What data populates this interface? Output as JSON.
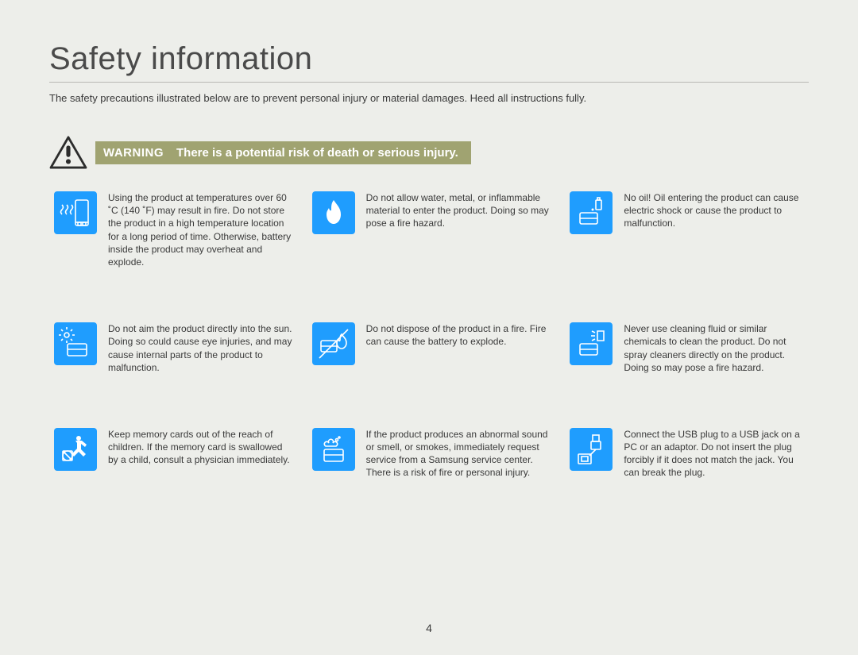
{
  "header": {
    "title": "Safety information",
    "intro": "The safety precautions illustrated below are to prevent personal injury or material damages. Heed all instructions fully."
  },
  "warning": {
    "label": "WARNING",
    "text": "There is a potential risk of death or serious injury."
  },
  "items": [
    {
      "text": "Using the product at temperatures over 60 ˚C (140 ˚F) may result in fire. Do not store the product in a high temperature location for a long period of time. Otherwise, battery inside the product may overheat and explode."
    },
    {
      "text": "Do not allow water, metal, or inflammable material to enter the product. Doing so may pose a fire hazard."
    },
    {
      "text": "No oil! Oil entering the product can cause electric shock or cause the product to malfunction."
    },
    {
      "text": "Do not aim the product directly into the sun. Doing so could cause eye injuries, and may cause internal parts of the product to malfunction."
    },
    {
      "text": "Do not dispose of the product in a fire. Fire can cause the battery to explode."
    },
    {
      "text": "Never use cleaning fluid or similar chemicals to clean the product. Do not spray cleaners directly on the product. Doing so may pose a fire hazard."
    },
    {
      "text": "Keep memory cards out of the reach of children. If the memory card is swallowed by a child, consult a physician immediately."
    },
    {
      "text": "If the product produces an abnormal sound or smell, or smokes, immediately request service from a Samsung service center. There is a risk of fire or personal injury."
    },
    {
      "text": "Connect the USB plug to a USB jack on a PC or an adaptor. Do not insert the plug forcibly if it does not match the jack. You can break the plug."
    }
  ],
  "page_number": "4"
}
